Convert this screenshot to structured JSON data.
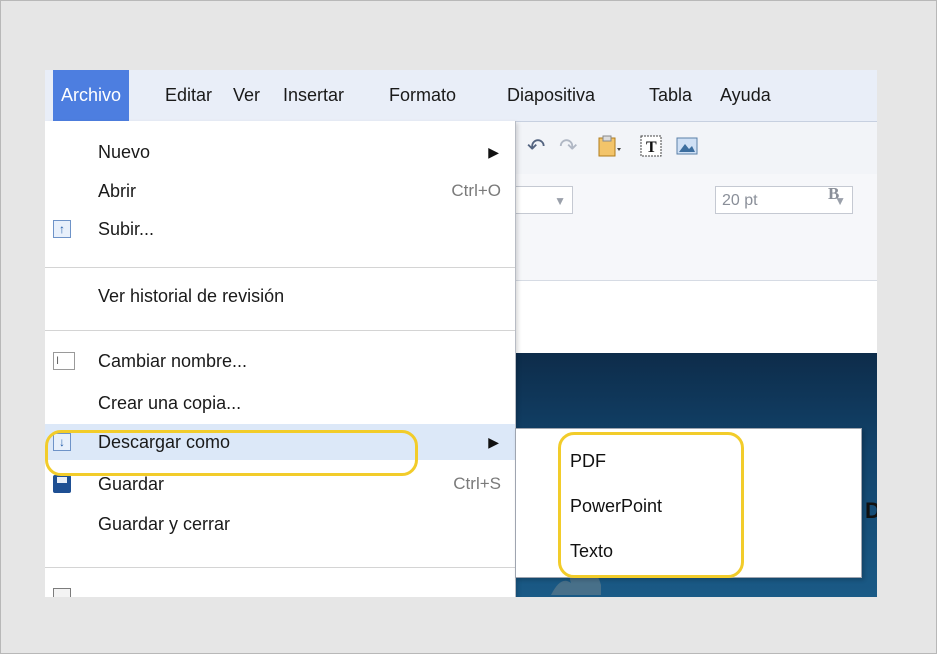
{
  "menubar": {
    "items": [
      "Archivo",
      "Editar",
      "Ver",
      "Insertar",
      "Formato",
      "Diapositiva",
      "Tabla",
      "Ayuda"
    ],
    "active": "Archivo"
  },
  "toolbar": {
    "font_size": "20 pt",
    "bold_label": "B"
  },
  "file_menu": {
    "nuevo": "Nuevo",
    "abrir": "Abrir",
    "abrir_shortcut": "Ctrl+O",
    "subir": "Subir...",
    "historial": "Ver historial de revisión",
    "cambiar_nombre": "Cambiar nombre...",
    "crear_copia": "Crear una copia...",
    "descargar": "Descargar como",
    "guardar": "Guardar",
    "guardar_shortcut": "Ctrl+S",
    "guardar_cerrar": "Guardar y cerrar"
  },
  "download_submenu": {
    "items": [
      "PDF",
      "PowerPoint",
      "Texto"
    ]
  },
  "slide": {
    "partial_text": "Da"
  },
  "colors": {
    "menu_active": "#4d7ee0",
    "highlight_row": "#dce8f8",
    "annotation": "#f2cc2a"
  }
}
